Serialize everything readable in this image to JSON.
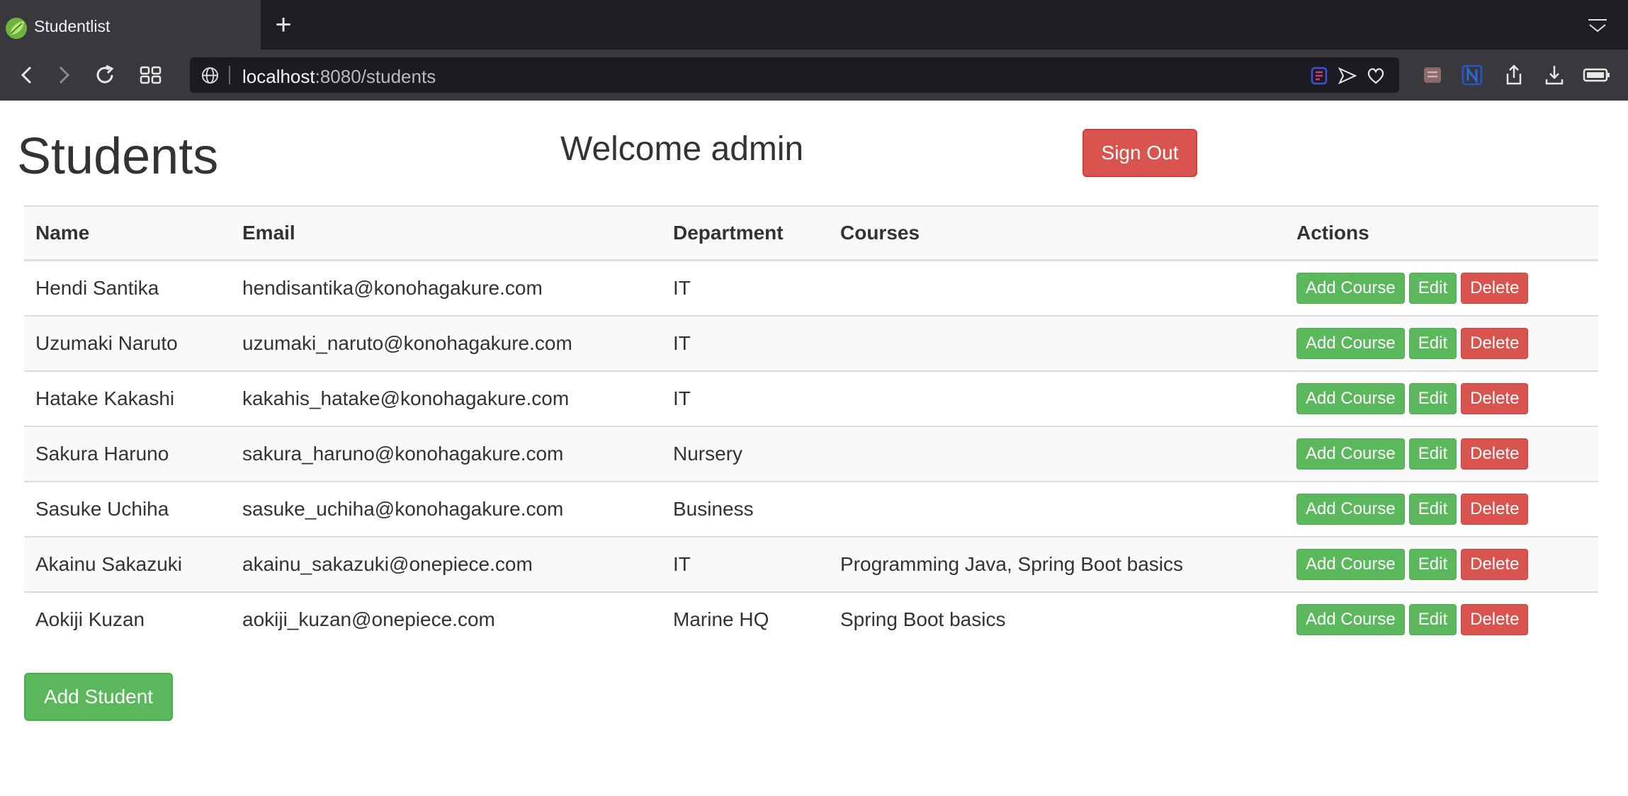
{
  "browser": {
    "tab_title": "Studentlist",
    "url_host": "localhost",
    "url_rest": ":8080/students"
  },
  "page": {
    "title": "Students",
    "welcome": "Welcome admin",
    "sign_out_label": "Sign Out",
    "add_student_label": "Add Student"
  },
  "table": {
    "headers": {
      "name": "Name",
      "email": "Email",
      "department": "Department",
      "courses": "Courses",
      "actions": "Actions"
    },
    "action_labels": {
      "add_course": "Add Course",
      "edit": "Edit",
      "delete": "Delete"
    },
    "rows": [
      {
        "name": "Hendi Santika",
        "email": "hendisantika@konohagakure.com",
        "department": "IT",
        "courses": ""
      },
      {
        "name": "Uzumaki Naruto",
        "email": "uzumaki_naruto@konohagakure.com",
        "department": "IT",
        "courses": ""
      },
      {
        "name": "Hatake Kakashi",
        "email": "kakahis_hatake@konohagakure.com",
        "department": "IT",
        "courses": ""
      },
      {
        "name": "Sakura Haruno",
        "email": "sakura_haruno@konohagakure.com",
        "department": "Nursery",
        "courses": ""
      },
      {
        "name": "Sasuke Uchiha",
        "email": "sasuke_uchiha@konohagakure.com",
        "department": "Business",
        "courses": ""
      },
      {
        "name": "Akainu Sakazuki",
        "email": "akainu_sakazuki@onepiece.com",
        "department": "IT",
        "courses": "Programming Java, Spring Boot basics"
      },
      {
        "name": "Aokiji Kuzan",
        "email": "aokiji_kuzan@onepiece.com",
        "department": "Marine HQ",
        "courses": "Spring Boot basics"
      }
    ]
  },
  "colors": {
    "success": "#5cb85c",
    "danger": "#d9534f",
    "chrome_dark": "#1f1f23",
    "chrome": "#38383d"
  },
  "icons": [
    "spring-leaf-icon",
    "new-tab-icon",
    "tabs-menu-icon",
    "back-icon",
    "forward-icon",
    "reload-icon",
    "grid-icon",
    "globe-icon",
    "extension-icon",
    "send-icon",
    "heart-icon",
    "share-icon",
    "download-icon",
    "battery-icon"
  ]
}
